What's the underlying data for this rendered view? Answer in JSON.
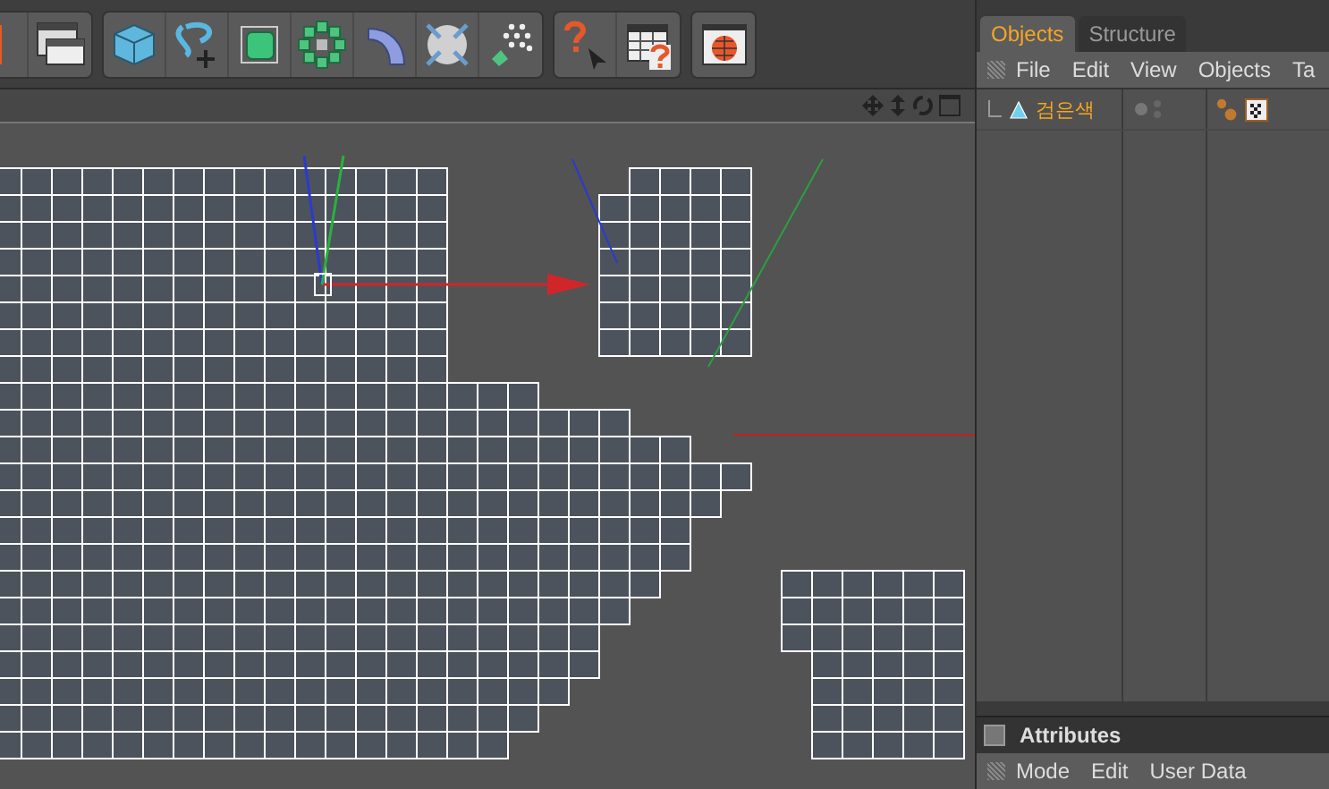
{
  "object_manager": {
    "tabs": [
      {
        "label": "Objects",
        "selected": true
      },
      {
        "label": "Structure",
        "selected": false
      }
    ],
    "menu": [
      "File",
      "Edit",
      "View",
      "Objects",
      "Ta"
    ],
    "objects": [
      {
        "name": "검은색",
        "selected": true
      }
    ]
  },
  "attributes": {
    "title": "Attributes",
    "menu": [
      "Mode",
      "Edit",
      "User Data"
    ]
  }
}
